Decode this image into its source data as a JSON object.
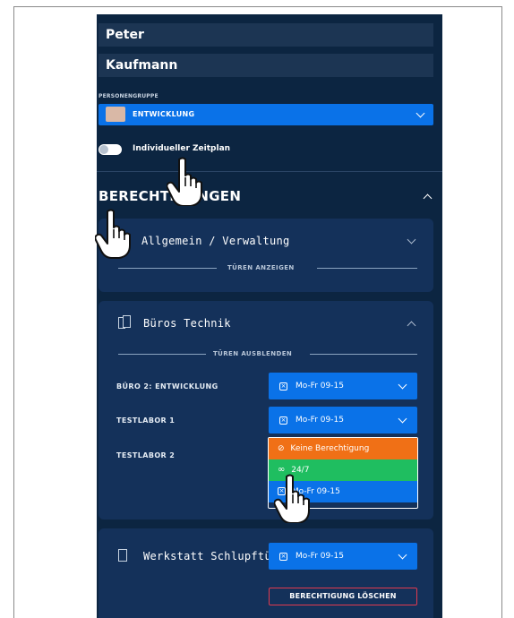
{
  "person": {
    "first_name": "Peter",
    "last_name": "Kaufmann"
  },
  "group": {
    "label": "PERSONENGRUPPE",
    "selected": "ENTWICKLUNG",
    "swatch_color": "#d9b8a6"
  },
  "schedule_toggle": {
    "label": "Individueller Zeitplan",
    "on": false
  },
  "permissions": {
    "title": "BERECHTIGUNGEN",
    "cards": [
      {
        "title": "Allgemein / Verwaltung",
        "toggle_doors_label": "TÜREN ANZEIGEN"
      },
      {
        "title": "Büros Technik",
        "toggle_doors_label": "TÜREN AUSBLENDEN",
        "rows": [
          {
            "label": "BÜRO 2: ENTWICKLUNG",
            "value": "Mo-Fr 09-15"
          },
          {
            "label": "TESTLABOR 1",
            "value": "Mo-Fr 09-15"
          },
          {
            "label": "TESTLABOR 2",
            "value": ""
          }
        ],
        "dropdown_options": [
          {
            "label": "Keine Berechtigung",
            "color": "#f07016",
            "icon": "block-icon"
          },
          {
            "label": "24/7",
            "color": "#1fbe60",
            "icon": "infinity-icon"
          },
          {
            "label": "Mo-Fr 09-15",
            "color": "#0a72e8",
            "icon": "x-box-icon"
          }
        ]
      },
      {
        "title": "Werkstatt Schlupftür",
        "value": "Mo-Fr 09-15",
        "delete_label": "BERECHTIGUNG LÖSCHEN"
      }
    ]
  },
  "colors": {
    "background": "#0c2541",
    "card": "#14315a",
    "field": "#1c3553",
    "accent_blue": "#0a72e8",
    "orange": "#f07016",
    "green": "#1fbe60",
    "danger": "#e23a4f"
  }
}
